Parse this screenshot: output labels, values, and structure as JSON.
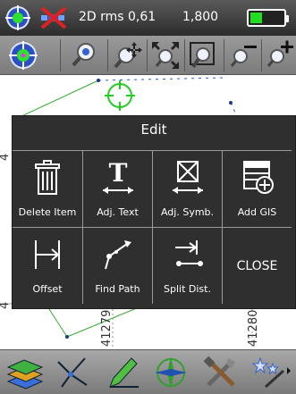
{
  "status": {
    "mode": "2D rms 0,61",
    "value": "1,800",
    "battery_level": 0.35
  },
  "toolbar": {
    "buttons": [
      "gps-locate",
      "zoom-to-gps",
      "pan",
      "zoom-extents",
      "zoom-window",
      "zoom-out",
      "zoom-in"
    ]
  },
  "map": {
    "grid_label_left_top": "4",
    "grid_label_left_bottom": "4",
    "grid_label_1": "41279",
    "grid_label_2": "41280"
  },
  "dialog": {
    "title": "Edit",
    "items": [
      {
        "label": "Delete Item",
        "icon": "trash-icon"
      },
      {
        "label": "Adj. Text",
        "icon": "text-icon"
      },
      {
        "label": "Adj. Symb.",
        "icon": "symbol-icon"
      },
      {
        "label": "Add GIS",
        "icon": "add-gis-icon"
      },
      {
        "label": "Offset",
        "icon": "offset-icon"
      },
      {
        "label": "Find Path",
        "icon": "find-path-icon"
      },
      {
        "label": "Split Dist.",
        "icon": "split-icon"
      },
      {
        "label": "CLOSE",
        "icon": ""
      }
    ]
  },
  "colors": {
    "gps_green": "#22cc22",
    "dialog_bg": "#2f2f2f",
    "map_line": "#33aa33"
  }
}
